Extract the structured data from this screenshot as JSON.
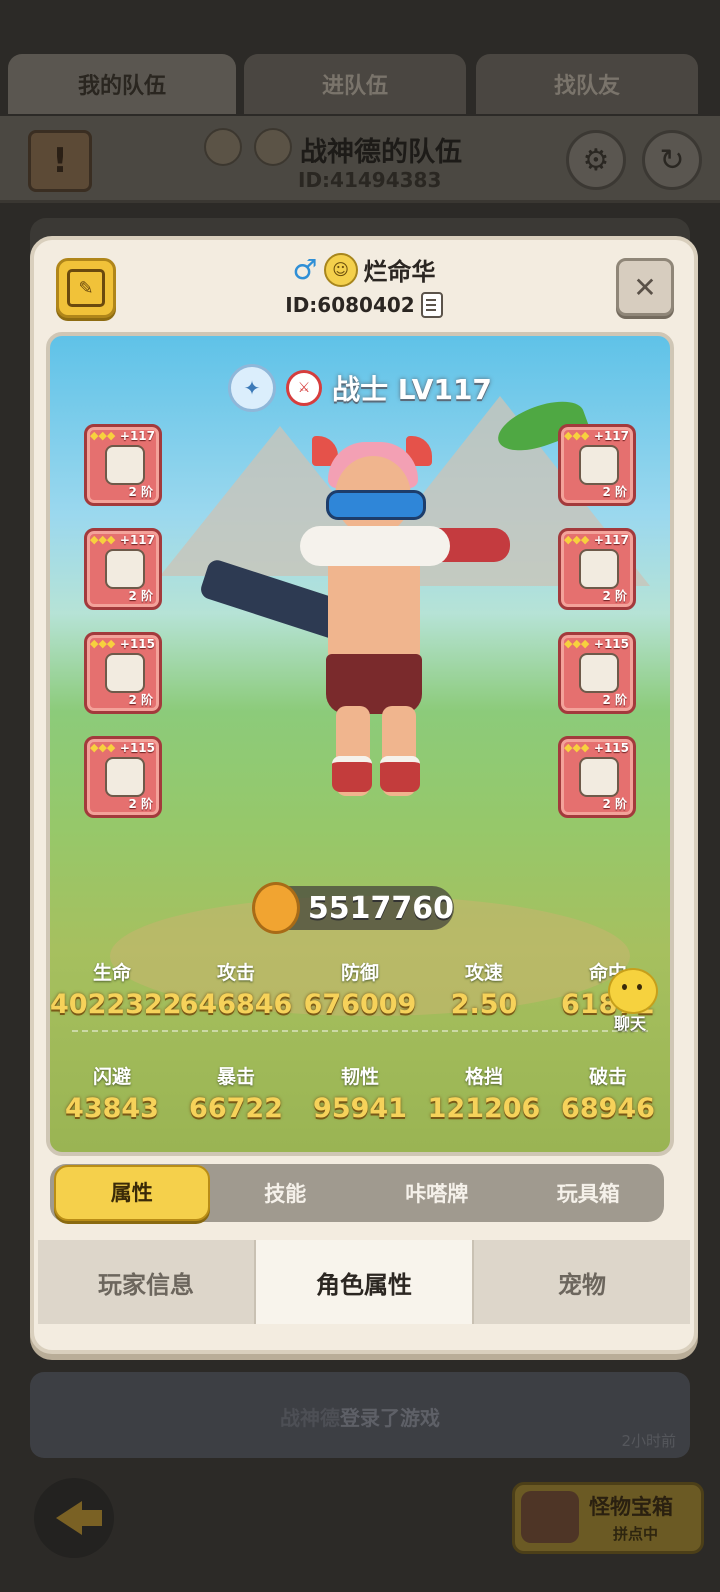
{
  "top_tabs": [
    "我的队伍",
    "进队伍",
    "找队友"
  ],
  "team": {
    "name": "战神德的队伍",
    "id": "ID:41494383"
  },
  "profile": {
    "gender_icon": "male-icon",
    "name": "烂命华",
    "id": "ID:6080402",
    "class_name": "战士 LV117",
    "combat_power": "5517760"
  },
  "equipment": {
    "left": [
      {
        "plus": "+117",
        "tier": "2 阶"
      },
      {
        "plus": "+117",
        "tier": "2 阶"
      },
      {
        "plus": "+115",
        "tier": "2 阶"
      },
      {
        "plus": "+115",
        "tier": "2 阶"
      }
    ],
    "right": [
      {
        "plus": "+117",
        "tier": "2 阶"
      },
      {
        "plus": "+117",
        "tier": "2 阶"
      },
      {
        "plus": "+115",
        "tier": "2 阶"
      },
      {
        "plus": "+115",
        "tier": "2 阶"
      }
    ]
  },
  "stats_row1": [
    {
      "label": "生命",
      "value": "4022322"
    },
    {
      "label": "攻击",
      "value": "646846"
    },
    {
      "label": "防御",
      "value": "676009"
    },
    {
      "label": "攻速",
      "value": "2.50"
    },
    {
      "label": "命中",
      "value": "61872"
    }
  ],
  "stats_row2": [
    {
      "label": "闪避",
      "value": "43843"
    },
    {
      "label": "暴击",
      "value": "66722"
    },
    {
      "label": "韧性",
      "value": "95941"
    },
    {
      "label": "格挡",
      "value": "121206"
    },
    {
      "label": "破击",
      "value": "68946"
    }
  ],
  "chat_button": "聊天",
  "sub_tabs": [
    "属性",
    "技能",
    "咔嗒牌",
    "玩具箱"
  ],
  "bottom_tabs": [
    "玩家信息",
    "角色属性",
    "宠物"
  ],
  "chat": {
    "who": "战神德",
    "message": "登录了游戏",
    "time": "2小时前"
  },
  "monster_box": {
    "title": "怪物宝箱",
    "sub": "拼点中"
  }
}
